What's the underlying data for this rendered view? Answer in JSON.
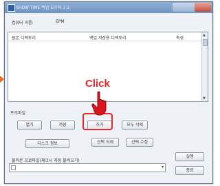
{
  "window": {
    "title": "SHOW TIME 백업 도우미 2.2"
  },
  "computer": {
    "label": "컴퓨터 이름:",
    "value": "EPM"
  },
  "columns": {
    "source": "원본 디렉토리",
    "backup": "백업 저장용 디렉토리",
    "attr": "속성"
  },
  "profile": {
    "label": "프로파일",
    "open": "열기",
    "save": "저장",
    "add": "추가",
    "delete_all": "모두 삭제",
    "disk_info": "디스크 정보",
    "delete_selected": "선택 삭제",
    "edit_selected": "선택 수정"
  },
  "load_label": "불러온 프로파일(체크시 자동 불러오기)",
  "run": "실행",
  "exit": "종료",
  "callout": {
    "text": "Click",
    "color": "#e8272a"
  },
  "colors": {
    "titlebar": "#6f94c3",
    "highlight": "#e8272a",
    "arrow": "#e8701a"
  }
}
